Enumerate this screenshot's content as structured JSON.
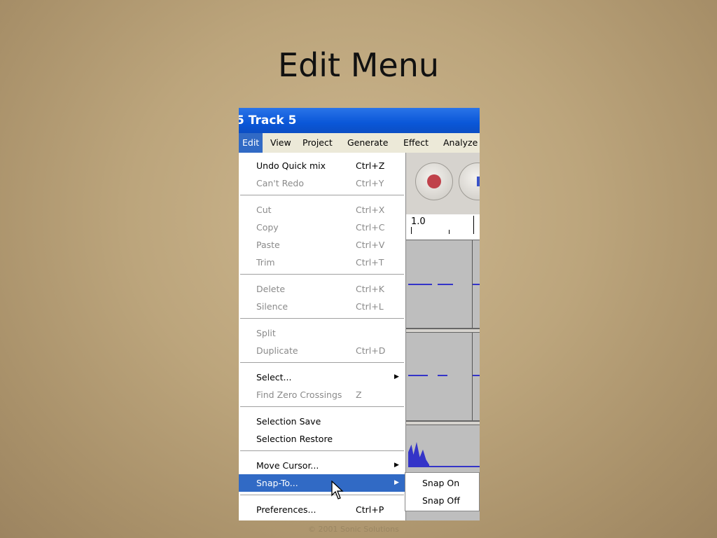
{
  "slide": {
    "title": "Edit Menu"
  },
  "window": {
    "title": "5 Track 5"
  },
  "menubar": {
    "items": [
      "Edit",
      "View",
      "Project",
      "Generate",
      "Effect",
      "Analyze"
    ]
  },
  "ruler": {
    "label": "1.0"
  },
  "edit_menu": {
    "items": [
      {
        "label": "Undo Quick mix",
        "shortcut": "Ctrl+Z",
        "enabled": true
      },
      {
        "label": "Can't Redo",
        "shortcut": "Ctrl+Y",
        "enabled": false
      },
      {
        "label": "Cut",
        "shortcut": "Ctrl+X",
        "enabled": false
      },
      {
        "label": "Copy",
        "shortcut": "Ctrl+C",
        "enabled": false
      },
      {
        "label": "Paste",
        "shortcut": "Ctrl+V",
        "enabled": false
      },
      {
        "label": "Trim",
        "shortcut": "Ctrl+T",
        "enabled": false
      },
      {
        "label": "Delete",
        "shortcut": "Ctrl+K",
        "enabled": false
      },
      {
        "label": "Silence",
        "shortcut": "Ctrl+L",
        "enabled": false
      },
      {
        "label": "Split",
        "shortcut": "",
        "enabled": false
      },
      {
        "label": "Duplicate",
        "shortcut": "Ctrl+D",
        "enabled": false
      },
      {
        "label": "Select...",
        "shortcut": "",
        "enabled": true,
        "submenu": true
      },
      {
        "label": "Find Zero Crossings",
        "shortcut": "Z",
        "enabled": false
      },
      {
        "label": "Selection Save",
        "shortcut": "",
        "enabled": true
      },
      {
        "label": "Selection Restore",
        "shortcut": "",
        "enabled": true
      },
      {
        "label": "Move Cursor...",
        "shortcut": "",
        "enabled": true,
        "submenu": true
      },
      {
        "label": "Snap-To...",
        "shortcut": "",
        "enabled": true,
        "submenu": true,
        "highlighted": true
      },
      {
        "label": "Preferences...",
        "shortcut": "Ctrl+P",
        "enabled": true
      }
    ]
  },
  "snap_submenu": {
    "items": [
      "Snap On",
      "Snap Off"
    ]
  },
  "footer": {
    "copyright": "© 2001 Sonic Solutions"
  },
  "colors": {
    "highlight": "#316ac5",
    "titlebar": "#0a57d8",
    "record": "#c0424b"
  }
}
